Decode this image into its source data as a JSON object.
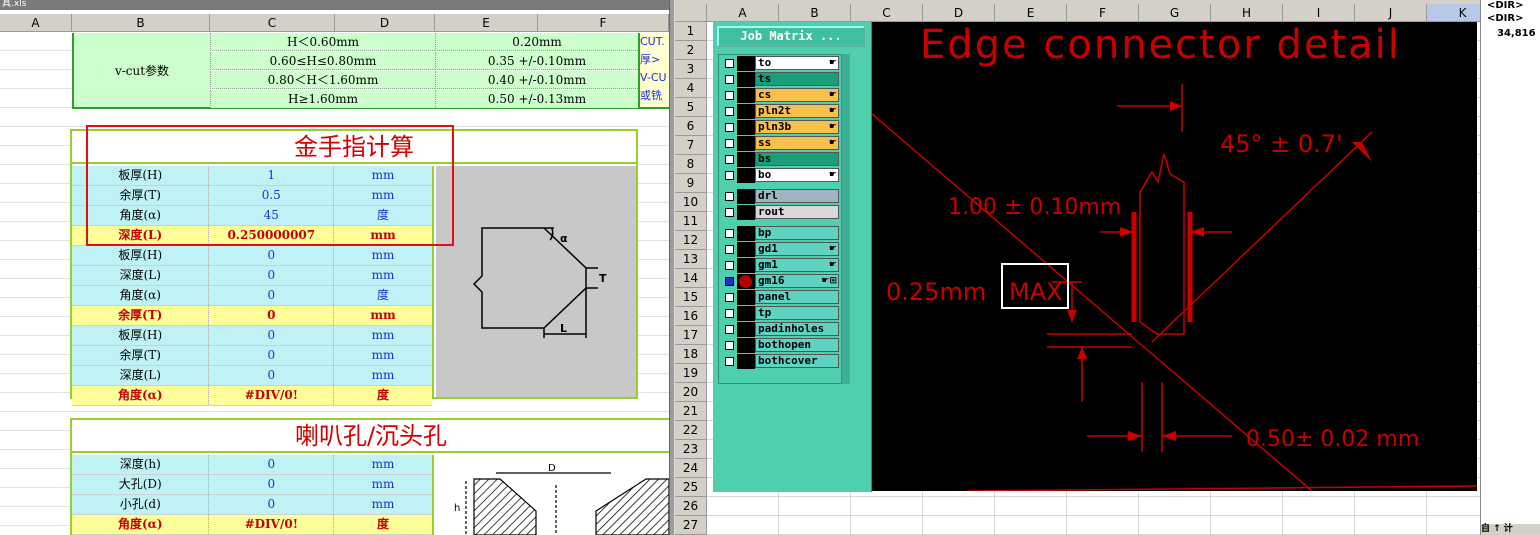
{
  "left_sheet": {
    "title_fragment": "具.xls",
    "columns": [
      "A",
      "B",
      "C",
      "D",
      "E",
      "F"
    ],
    "vcut": {
      "label": "v-cut参数",
      "rows": [
        {
          "thick": "H＜0.60mm",
          "val": "0.20mm"
        },
        {
          "thick": "0.60≤H≤0.80mm",
          "val": "0.35 +/-0.10mm"
        },
        {
          "thick": "0.80＜H＜1.60mm",
          "val": "0.40 +/-0.10mm"
        },
        {
          "thick": "H≥1.60mm",
          "val": "0.50 +/-0.13mm"
        }
      ],
      "side_notes": [
        "CUT.",
        "厚>",
        "V-CU",
        "或铣"
      ]
    },
    "gold_finger": {
      "title": "金手指计算",
      "rows": [
        {
          "label": "板厚(H)",
          "value": "1",
          "unit": "mm",
          "style": "cyan"
        },
        {
          "label": "余厚(T)",
          "value": "0.5",
          "unit": "mm",
          "style": "cyan"
        },
        {
          "label": "角度(α)",
          "value": "45",
          "unit": "度",
          "style": "cyan"
        },
        {
          "label": "深度(L)",
          "value": "0.250000007",
          "unit": "mm",
          "style": "result"
        },
        {
          "label": "板厚(H)",
          "value": "0",
          "unit": "mm",
          "style": "cyan"
        },
        {
          "label": "深度(L)",
          "value": "0",
          "unit": "mm",
          "style": "cyan"
        },
        {
          "label": "角度(α)",
          "value": "0",
          "unit": "度",
          "style": "cyan"
        },
        {
          "label": "余厚(T)",
          "value": "0",
          "unit": "mm",
          "style": "result"
        },
        {
          "label": "板厚(H)",
          "value": "0",
          "unit": "mm",
          "style": "cyan"
        },
        {
          "label": "余厚(T)",
          "value": "0",
          "unit": "mm",
          "style": "cyan"
        },
        {
          "label": "深度(L)",
          "value": "0",
          "unit": "mm",
          "style": "cyan"
        },
        {
          "label": "角度(α)",
          "value": "#DIV/0!",
          "unit": "度",
          "style": "result"
        }
      ],
      "diagram_labels": {
        "alpha": "α",
        "t": "T",
        "l": "L"
      }
    },
    "countersink": {
      "title": "喇叭孔/沉头孔",
      "rows": [
        {
          "label": "深度(h)",
          "value": "0",
          "unit": "mm",
          "style": "cyan"
        },
        {
          "label": "大孔(D)",
          "value": "0",
          "unit": "mm",
          "style": "cyan"
        },
        {
          "label": "小孔(d)",
          "value": "0",
          "unit": "mm",
          "style": "cyan"
        },
        {
          "label": "角度(α)",
          "value": "#DIV/0!",
          "unit": "度",
          "style": "result"
        }
      ],
      "diagram_labels": {
        "d_big": "D",
        "h": "h"
      }
    }
  },
  "right_sheet": {
    "columns": [
      "A",
      "B",
      "C",
      "D",
      "E",
      "F",
      "G",
      "H",
      "I",
      "J",
      "K"
    ],
    "rows": [
      "1",
      "2",
      "3",
      "4",
      "5",
      "6",
      "7",
      "8",
      "9",
      "10",
      "11",
      "12",
      "13",
      "14",
      "15",
      "16",
      "17",
      "18",
      "19",
      "20",
      "21",
      "22",
      "23",
      "24",
      "25",
      "26",
      "27"
    ],
    "job_matrix": {
      "button": "Job Matrix ...",
      "layers": [
        {
          "name": "to",
          "color": "#ffffff",
          "mark": "☛"
        },
        {
          "name": "ts",
          "color": "#1a9f7a",
          "mark": ""
        },
        {
          "name": "cs",
          "color": "#f7c04a",
          "mark": "☛"
        },
        {
          "name": "pln2t",
          "color": "#f7c04a",
          "mark": "☛"
        },
        {
          "name": "pln3b",
          "color": "#f7c04a",
          "mark": "☛"
        },
        {
          "name": "ss",
          "color": "#f7c04a",
          "mark": "☛"
        },
        {
          "name": "bs",
          "color": "#1a9f7a",
          "mark": ""
        },
        {
          "name": "bo",
          "color": "#ffffff",
          "mark": "☛"
        },
        {
          "name": "drl",
          "color": "#9fb5c2",
          "mark": ""
        },
        {
          "name": "rout",
          "color": "#d8d8d8",
          "mark": ""
        },
        {
          "name": "bp",
          "color": "#5fd3c2",
          "mark": ""
        },
        {
          "name": "gd1",
          "color": "#5fd3c2",
          "mark": "☛"
        },
        {
          "name": "gm1",
          "color": "#5fd3c2",
          "mark": "☛"
        },
        {
          "name": "gm16",
          "color": "#5fd3c2",
          "mark": "☛⊞"
        },
        {
          "name": "panel",
          "color": "#5fd3c2",
          "mark": ""
        },
        {
          "name": "tp",
          "color": "#5fd3c2",
          "mark": ""
        },
        {
          "name": "padinholes",
          "color": "#5fd3c2",
          "mark": ""
        },
        {
          "name": "bothopen",
          "color": "#5fd3c2",
          "mark": ""
        },
        {
          "name": "bothcover",
          "color": "#5fd3c2",
          "mark": ""
        }
      ]
    },
    "cad": {
      "title": "Edge connector detail",
      "angle": "45° ± 0.7'",
      "thickness": "1.00 ± 0.10mm",
      "depth": "0.25mm",
      "max": "MAX",
      "width": "0.50± 0.02 mm"
    }
  },
  "far_right": {
    "lines": [
      "<DIR>",
      "<DIR>",
      "34,816"
    ],
    "bottom": "自 ↑ 计"
  }
}
